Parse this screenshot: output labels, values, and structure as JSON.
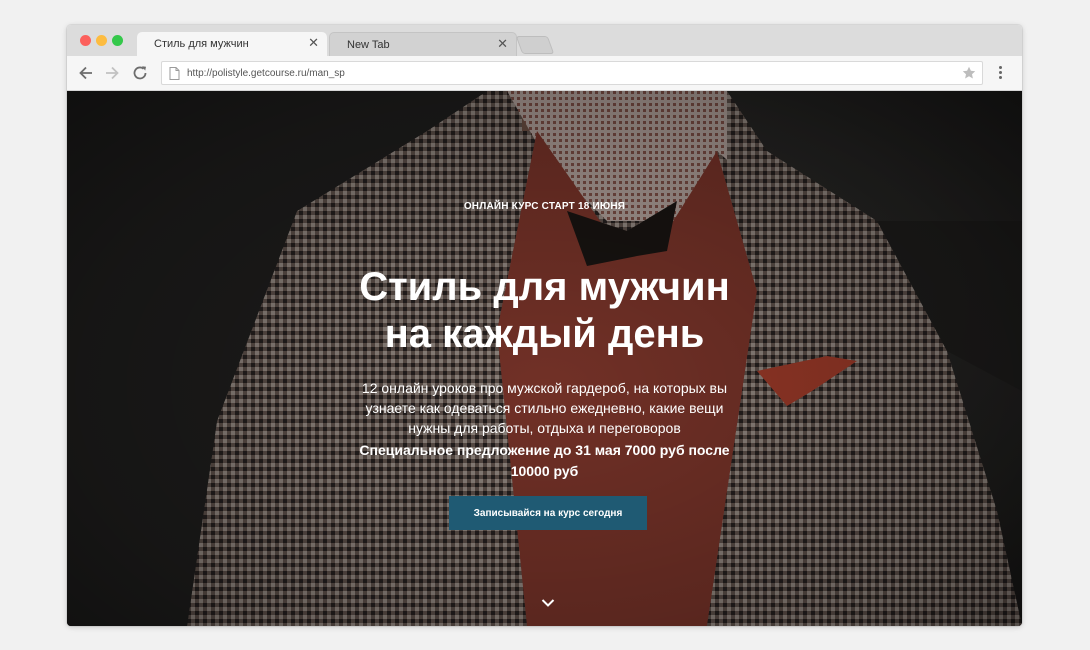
{
  "browser": {
    "tabs": [
      {
        "title": "Стиль для мужчин",
        "close": "✕"
      },
      {
        "title": "New Tab",
        "close": "✕"
      }
    ],
    "address_bar": {
      "url": "http://polistyle.getcourse.ru/man_sp"
    },
    "icons": [
      "back-arrow-icon",
      "forward-arrow-icon",
      "reload-icon",
      "page-icon",
      "bookmark-star-icon",
      "menu-dots-icon"
    ]
  },
  "hero": {
    "eyebrow": "ОНЛАЙН КУРС СТАРТ 18 ИЮНЯ",
    "headline_line1": "Стиль для мужчин",
    "headline_line2": "на каждый день",
    "lead": "12 онлайн уроков про мужской гардероб, на которых вы узнаете как одеваться стильно ежедневно, какие вещи нужны для работы, отдыха и переговоров",
    "offer": "Специальное предложение до 31 мая 7000 руб после 10000 руб",
    "cta_label": "Записывайся на курс сегодня",
    "scroll_icon": "chevron-down-icon"
  },
  "colors": {
    "cta_background": "#1f5a73",
    "hero_text": "#ffffff"
  }
}
